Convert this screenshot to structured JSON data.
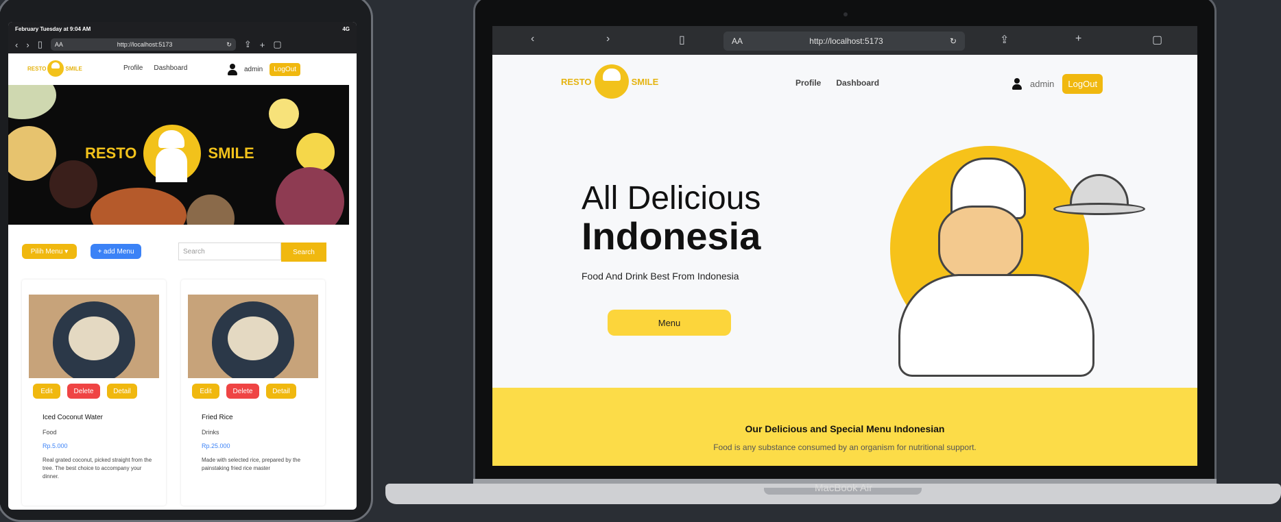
{
  "ipad": {
    "status_time": "February Tuesday at 9:04 AM",
    "status_right": "4G",
    "url": "http://localhost:5173",
    "aa": "AA",
    "brand_left": "RESTO",
    "brand_right": "SMILE",
    "nav": [
      "Profile",
      "Dashboard"
    ],
    "user": "admin",
    "logout": "LogOut",
    "hero_left": "RESTO",
    "hero_right": "SMILE",
    "pilih": "Pilih Menu",
    "add_menu": "+ add Menu",
    "search_placeholder": "Search",
    "search_button": "Search",
    "cards": [
      {
        "title": "Iced Coconut Water",
        "category": "Food",
        "price": "Rp.5.000",
        "desc": "Real grated coconut, picked straight from the tree. The best choice to accompany your dinner.",
        "edit": "Edit",
        "delete": "Delete",
        "detail": "Detail"
      },
      {
        "title": "Fried Rice",
        "category": "Drinks",
        "price": "Rp.25.000",
        "desc": "Made with selected rice, prepared by the painstaking fried rice master",
        "edit": "Edit",
        "delete": "Delete",
        "detail": "Detail"
      }
    ]
  },
  "mac": {
    "url": "http://localhost:5173",
    "aa": "AA",
    "brand_left": "RESTO",
    "brand_right": "SMILE",
    "nav": [
      "Profile",
      "Dashboard"
    ],
    "user": "admin",
    "logout": "LogOut",
    "hero_line1": "All Delicious",
    "hero_line2": "Indonesia",
    "hero_sub": "Food And Drink Best From Indonesia",
    "menu_button": "Menu",
    "band_title": "Our Delicious and Special Menu Indonesian",
    "band_sub": "Food is any substance consumed by an organism for nutritional support.",
    "device_label": "MacBook Air"
  },
  "colors": {
    "accent": "#f0b80f",
    "band": "#fcdc48",
    "danger": "#ef4444",
    "primary": "#3b82f6"
  }
}
